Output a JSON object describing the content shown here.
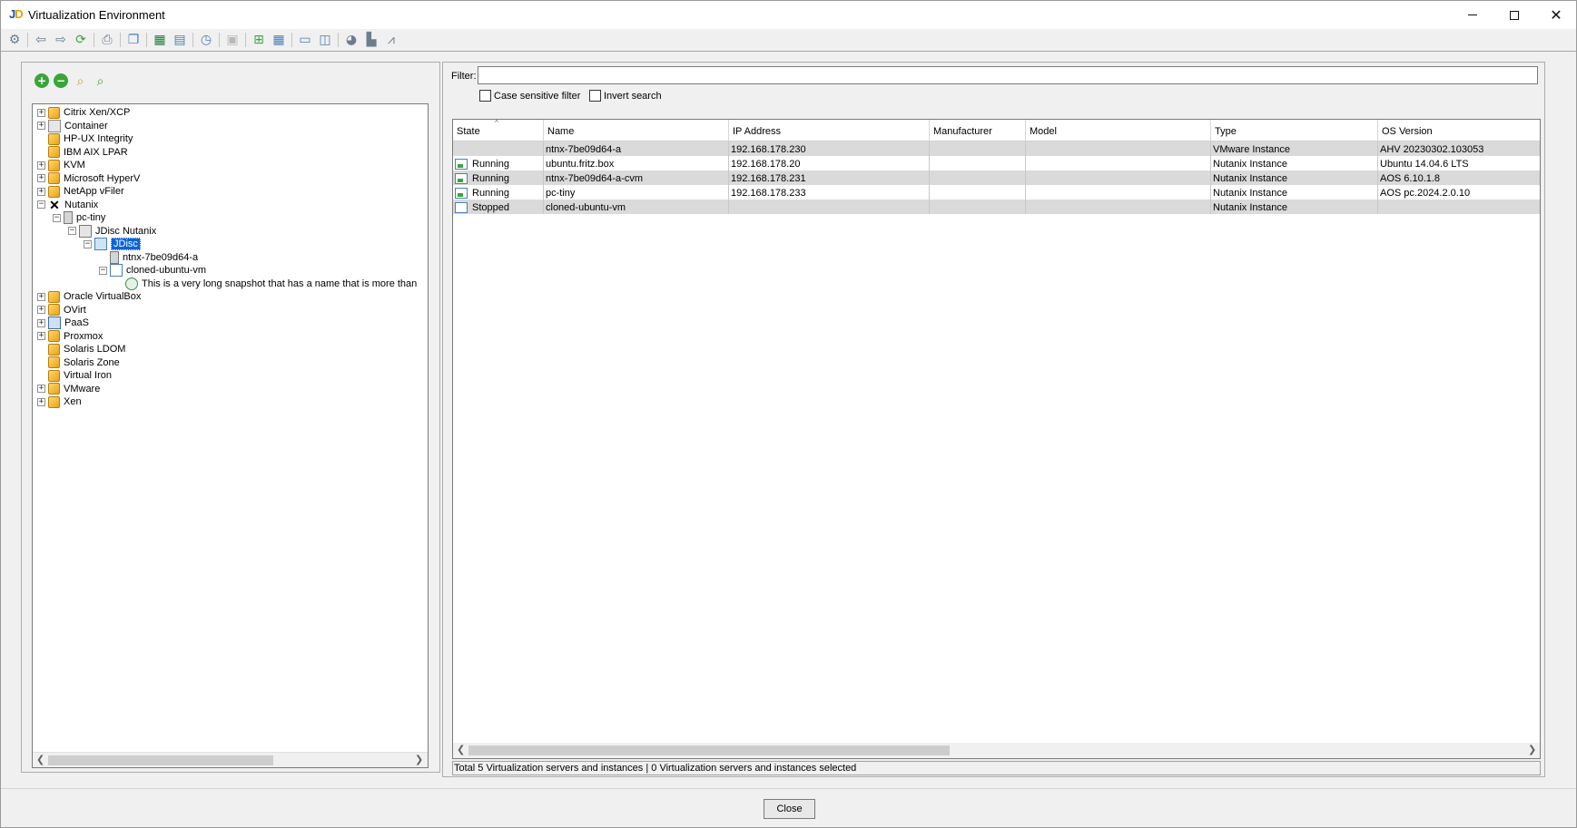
{
  "window": {
    "title": "Virtualization Environment",
    "logo_j": "J",
    "logo_d": "D",
    "minimize": "",
    "maximize": "",
    "close": "✕"
  },
  "toolbar": {
    "icons": [
      "gear-icon",
      "back-icon",
      "forward-icon",
      "refresh-icon",
      "print-icon",
      "copy-icon",
      "excel-icon",
      "export-icon",
      "clock-icon",
      "disabled-icon",
      "hierarchy-icon",
      "table-icon",
      "layout-icon",
      "split-icon",
      "pie-icon",
      "bar-chart-icon",
      "line-chart-icon"
    ]
  },
  "tree": {
    "items": [
      {
        "label": "Citrix Xen/XCP",
        "icon": "cube",
        "exp": "+",
        "level": 0
      },
      {
        "label": "Container",
        "icon": "container",
        "exp": "+",
        "level": 0
      },
      {
        "label": "HP-UX Integrity",
        "icon": "cube",
        "exp": "",
        "level": 0
      },
      {
        "label": "IBM AIX LPAR",
        "icon": "cube",
        "exp": "",
        "level": 0
      },
      {
        "label": "KVM",
        "icon": "cube",
        "exp": "+",
        "level": 0
      },
      {
        "label": "Microsoft HyperV",
        "icon": "cube",
        "exp": "+",
        "level": 0
      },
      {
        "label": "NetApp vFiler",
        "icon": "cube",
        "exp": "+",
        "level": 0
      },
      {
        "label": "Nutanix",
        "icon": "nutanix",
        "exp": "−",
        "level": 0
      },
      {
        "label": "pc-tiny",
        "icon": "server",
        "exp": "−",
        "level": 1
      },
      {
        "label": "JDisc Nutanix",
        "icon": "cluster",
        "exp": "−",
        "level": 2
      },
      {
        "label": "JDisc",
        "icon": "host",
        "exp": "−",
        "level": 3,
        "selected": true
      },
      {
        "label": "ntnx-7be09d64-a",
        "icon": "server",
        "exp": "",
        "level": 4
      },
      {
        "label": "cloned-ubuntu-vm",
        "icon": "vm",
        "exp": "−",
        "level": 4
      },
      {
        "label": "This is a very long snapshot that has a name that is more than",
        "icon": "snap",
        "exp": "",
        "level": 5
      },
      {
        "label": "Oracle VirtualBox",
        "icon": "cube",
        "exp": "+",
        "level": 0
      },
      {
        "label": "OVirt",
        "icon": "cube",
        "exp": "+",
        "level": 0
      },
      {
        "label": "PaaS",
        "icon": "paas",
        "exp": "+",
        "level": 0
      },
      {
        "label": "Proxmox",
        "icon": "cube",
        "exp": "+",
        "level": 0
      },
      {
        "label": "Solaris LDOM",
        "icon": "cube",
        "exp": "",
        "level": 0
      },
      {
        "label": "Solaris Zone",
        "icon": "cube",
        "exp": "",
        "level": 0
      },
      {
        "label": "Virtual Iron",
        "icon": "cube",
        "exp": "",
        "level": 0
      },
      {
        "label": "VMware",
        "icon": "cube",
        "exp": "+",
        "level": 0
      },
      {
        "label": "Xen",
        "icon": "cube",
        "exp": "+",
        "level": 0
      }
    ]
  },
  "filter": {
    "label": "Filter:",
    "value": "",
    "case_sensitive_label": "Case sensitive filter",
    "invert_label": "Invert search"
  },
  "table": {
    "columns": [
      "State",
      "Name",
      "IP Address",
      "Manufacturer",
      "Model",
      "Type",
      "OS Version"
    ],
    "rows": [
      {
        "state": "",
        "name": "ntnx-7be09d64-a",
        "ip": "192.168.178.230",
        "manufacturer": "",
        "model": "",
        "type": "VMware Instance",
        "os": "AHV 20230302.103053"
      },
      {
        "state": "Running",
        "name": "ubuntu.fritz.box",
        "ip": "192.168.178.20",
        "manufacturer": "",
        "model": "",
        "type": "Nutanix Instance",
        "os": "Ubuntu 14.04.6 LTS"
      },
      {
        "state": "Running",
        "name": "ntnx-7be09d64-a-cvm",
        "ip": "192.168.178.231",
        "manufacturer": "",
        "model": "",
        "type": "Nutanix Instance",
        "os": "AOS 6.10.1.8"
      },
      {
        "state": "Running",
        "name": "pc-tiny",
        "ip": "192.168.178.233",
        "manufacturer": "",
        "model": "",
        "type": "Nutanix Instance",
        "os": "AOS pc.2024.2.0.10"
      },
      {
        "state": "Stopped",
        "name": "cloned-ubuntu-vm",
        "ip": "",
        "manufacturer": "",
        "model": "",
        "type": "Nutanix Instance",
        "os": ""
      }
    ]
  },
  "status": "Total 5 Virtualization servers and instances | 0 Virtualization servers and instances selected",
  "close_label": "Close"
}
